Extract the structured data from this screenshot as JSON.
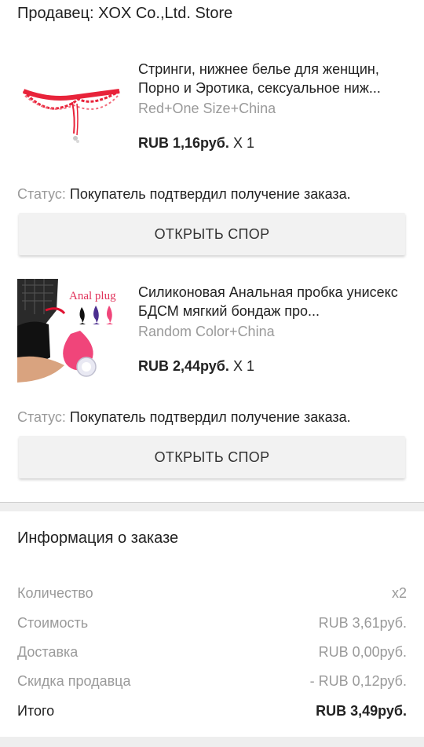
{
  "seller": {
    "label": "Продавец: XOX Co.,Ltd. Store"
  },
  "items": [
    {
      "title": "Стринги, нижнее белье для женщин, Порно и Эротика, сексуальное ниж...",
      "variant": "Red+One Size+China",
      "price": "RUB 1,16руб.",
      "qty": "X 1",
      "status_label": "Статус:",
      "status_value": "Покупатель подтвердил получение заказа.",
      "button": "ОТКРЫТЬ СПОР",
      "image_icon": "lace-thong-image"
    },
    {
      "title": "Силиконовая Анальная пробка унисекс БДСМ мягкий бондаж про...",
      "variant": "Random Color+China",
      "price": "RUB 2,44руб.",
      "qty": "X 1",
      "status_label": "Статус:",
      "status_value": "Покупатель подтвердил получение заказа.",
      "button": "ОТКРЫТЬ СПОР",
      "image_icon": "silicone-plug-image",
      "image_caption": "Anal plug"
    }
  ],
  "order_info": {
    "title": "Информация о заказе",
    "rows": [
      {
        "label": "Количество",
        "value": "x2"
      },
      {
        "label": "Стоимость",
        "value": "RUB 3,61руб."
      },
      {
        "label": "Доставка",
        "value": "RUB 0,00руб."
      },
      {
        "label": "Скидка продавца",
        "value": "- RUB 0,12руб."
      },
      {
        "label": "Итого",
        "value": "RUB 3,49руб."
      }
    ]
  },
  "colors": {
    "accent_red": "#e8233a",
    "pink": "#f0457a",
    "muted": "#9a9a9a"
  }
}
